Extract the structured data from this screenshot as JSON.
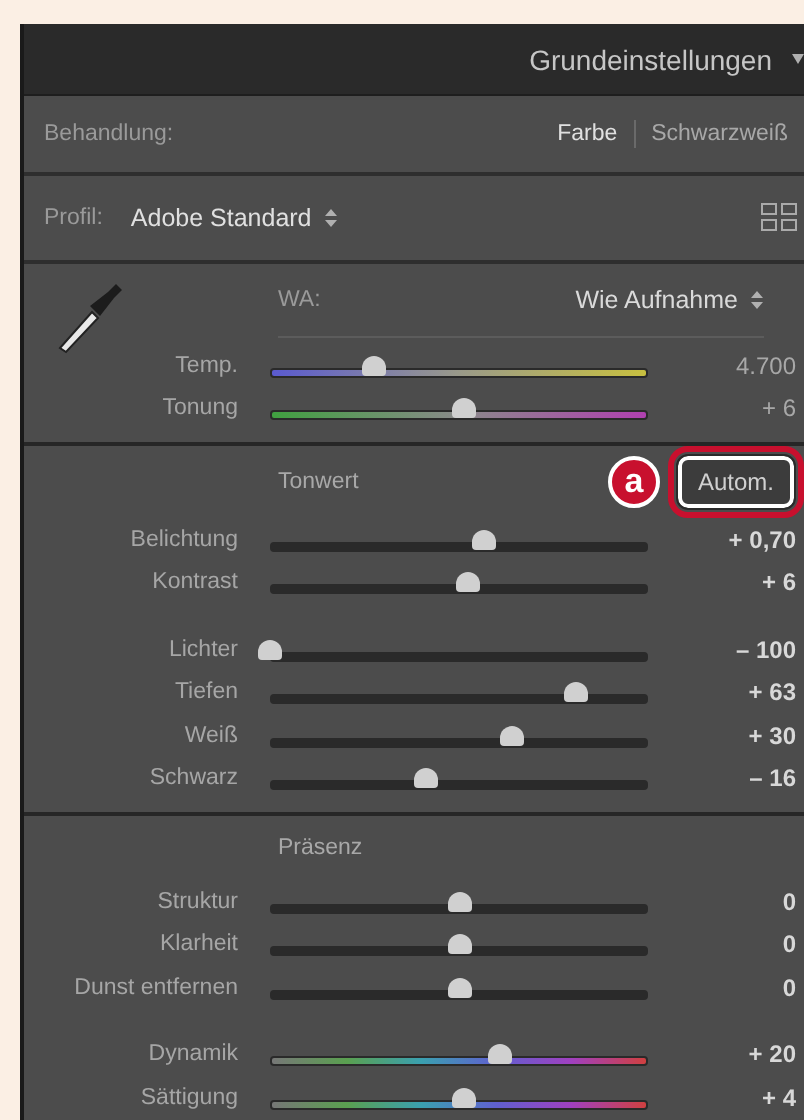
{
  "header": {
    "title": "Grundeinstellungen"
  },
  "treatment": {
    "label": "Behandlung:",
    "options": [
      {
        "label": "Farbe",
        "selected": true
      },
      {
        "label": "Schwarzweiß",
        "selected": false
      }
    ]
  },
  "profile": {
    "label": "Profil:",
    "value": "Adobe Standard"
  },
  "white_balance": {
    "label": "WA:",
    "value": "Wie Aufnahme",
    "sliders": [
      {
        "name": "Temp.",
        "kind": "temperature",
        "level": 0.29,
        "reading": "4.700"
      },
      {
        "name": "Tonung",
        "kind": "tint",
        "level": 0.51,
        "reading": "+ 6"
      }
    ]
  },
  "tone": {
    "heading": "Tonwert",
    "callout": "a",
    "auto_button": "Autom.",
    "groups": [
      [
        {
          "name": "Belichtung",
          "kind": "plain",
          "level": 0.56,
          "reading": "+ 0,70"
        },
        {
          "name": "Kontrast",
          "kind": "plain",
          "level": 0.52,
          "reading": "+ 6"
        }
      ],
      [
        {
          "name": "Lichter",
          "kind": "plain",
          "level": 0.03,
          "reading": "– 100"
        },
        {
          "name": "Tiefen",
          "kind": "plain",
          "level": 0.79,
          "reading": "+ 63"
        },
        {
          "name": "Weiß",
          "kind": "plain",
          "level": 0.63,
          "reading": "+ 30"
        },
        {
          "name": "Schwarz",
          "kind": "plain",
          "level": 0.42,
          "reading": "– 16"
        }
      ]
    ]
  },
  "presence": {
    "heading": "Präsenz",
    "groups": [
      [
        {
          "name": "Struktur",
          "kind": "plain",
          "level": 0.5,
          "reading": "0"
        },
        {
          "name": "Klarheit",
          "kind": "plain",
          "level": 0.5,
          "reading": "0"
        },
        {
          "name": "Dunst entfernen",
          "kind": "plain",
          "level": 0.5,
          "reading": "0"
        }
      ],
      [
        {
          "name": "Dynamik",
          "kind": "spectrum",
          "level": 0.6,
          "reading": "+ 20"
        },
        {
          "name": "Sättigung",
          "kind": "spectrum",
          "level": 0.51,
          "reading": "+ 4"
        }
      ]
    ]
  }
}
